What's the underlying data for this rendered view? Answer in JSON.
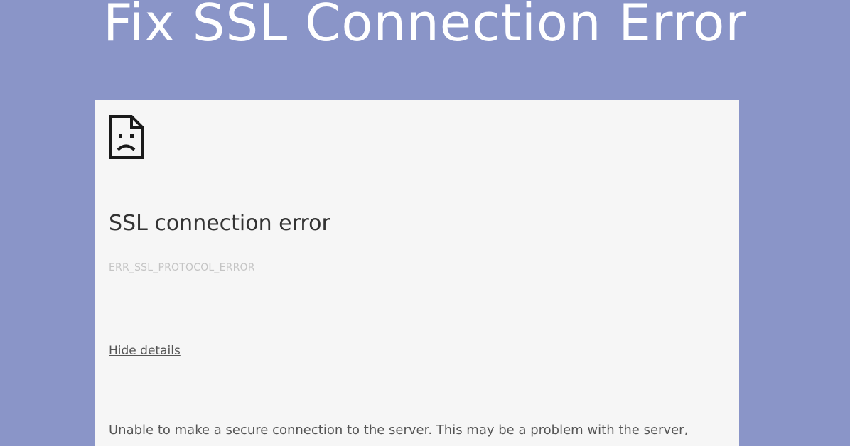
{
  "banner": {
    "title": "Fix SSL Connection Error"
  },
  "error_page": {
    "icon": "sad-page-icon",
    "heading": "SSL connection error",
    "code": "ERR_SSL_PROTOCOL_ERROR",
    "details_link": "Hide details",
    "description": "Unable to make a secure connection to the server. This may be a problem with the server,"
  },
  "colors": {
    "banner_background": "#8a95c8",
    "panel_background": "#f6f6f6",
    "banner_text": "#ffffff",
    "heading_text": "#333333",
    "code_text": "#c4c4c4",
    "body_text": "#555555"
  }
}
